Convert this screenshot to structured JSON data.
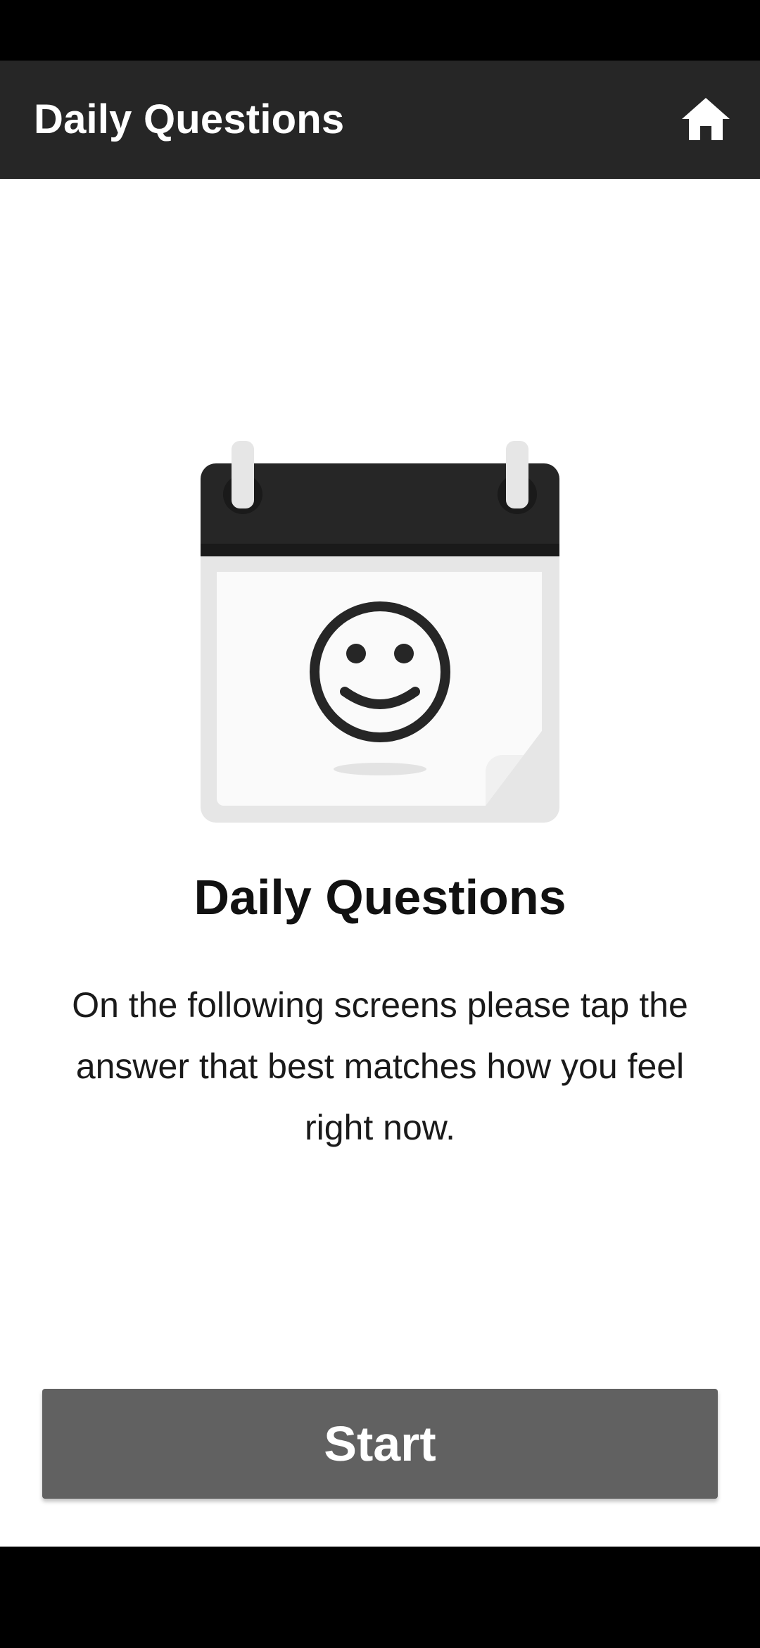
{
  "app_bar": {
    "title": "Daily Questions",
    "home_icon": "home-icon"
  },
  "illustration": {
    "icon": "calendar-smiley-icon"
  },
  "main": {
    "heading": "Daily Questions",
    "instructions": "On the following screens please tap the answer that best matches how you feel right now."
  },
  "actions": {
    "start_label": "Start"
  },
  "colors": {
    "app_bar_bg": "#262626",
    "button_bg": "#616161",
    "page_bg": "#ffffff"
  }
}
